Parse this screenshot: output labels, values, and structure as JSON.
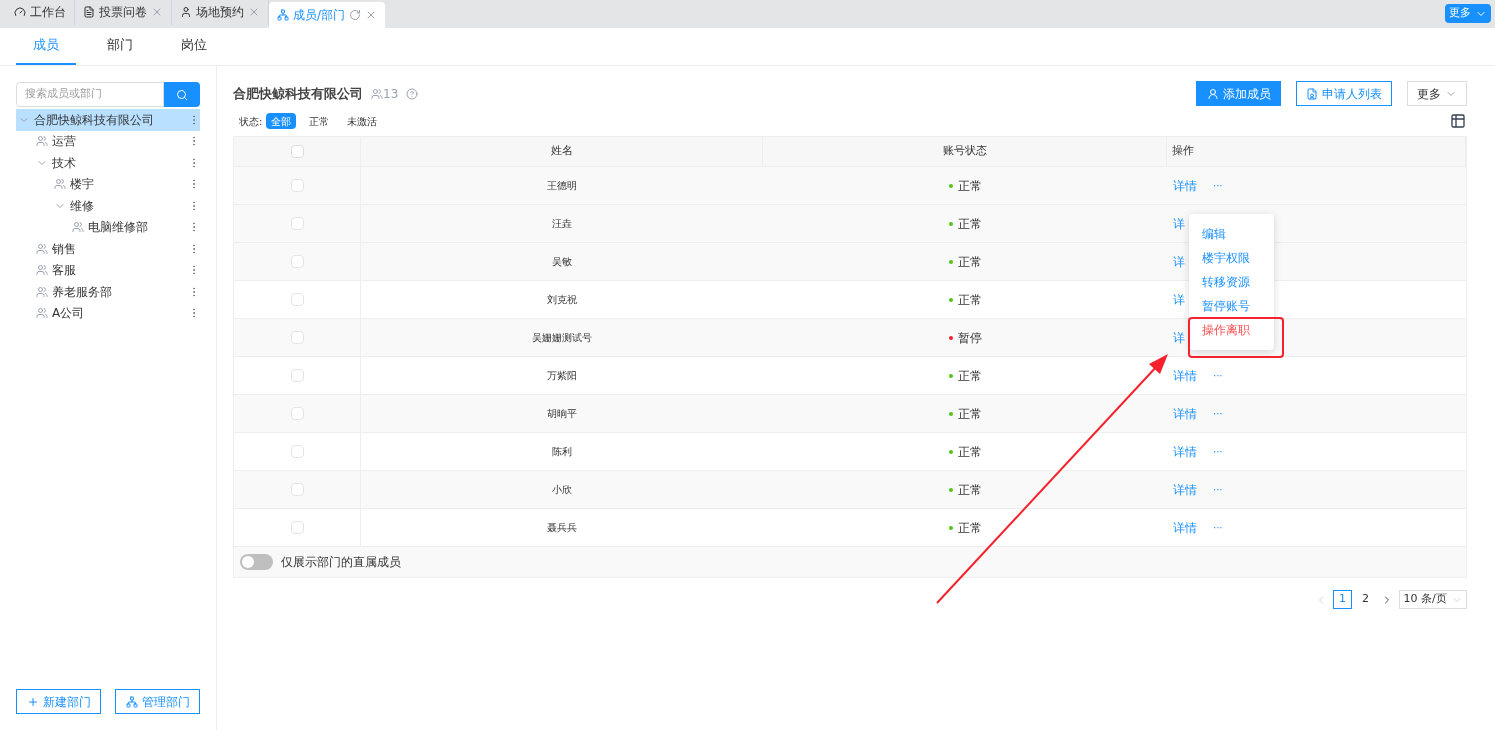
{
  "tabs": [
    {
      "label": "工作台",
      "selected": false,
      "closable": false
    },
    {
      "label": "投票问卷",
      "selected": false,
      "closable": true
    },
    {
      "label": "场地预约",
      "selected": false,
      "closable": true
    },
    {
      "label": "成员/部门",
      "selected": true,
      "closable": true
    }
  ],
  "more_button": "更多",
  "sub_tabs": [
    {
      "label": "成员",
      "selected": true
    },
    {
      "label": "部门",
      "selected": false
    },
    {
      "label": "岗位",
      "selected": false
    }
  ],
  "sidebar": {
    "search": {
      "placeholder": "搜索成员或部门"
    },
    "tree": [
      {
        "label": "合肥快鲸科技有限公司",
        "selected": true,
        "expanded": true,
        "children": [
          {
            "label": "运营",
            "selected": false
          },
          {
            "label": "技术",
            "selected": false,
            "expanded": true,
            "children": [
              {
                "label": "楼宇",
                "selected": false
              },
              {
                "label": "维修",
                "selected": false,
                "expanded": true,
                "children": [
                  {
                    "label": "电脑维修部",
                    "selected": false
                  }
                ]
              }
            ]
          },
          {
            "label": "销售",
            "selected": false
          },
          {
            "label": "客服",
            "selected": false
          },
          {
            "label": "养老服务部",
            "selected": false
          },
          {
            "label": "A公司",
            "selected": false
          }
        ]
      }
    ],
    "buttons": [
      "新建部门",
      "管理部门"
    ]
  },
  "header": {
    "company": "合肥快鲸科技有限公司",
    "member_count": "13",
    "buttons": [
      {
        "label": "添加成员",
        "kind": "primary"
      },
      {
        "label": "申请人列表",
        "kind": "outline"
      },
      {
        "label": "更多",
        "kind": "dropdown"
      }
    ]
  },
  "filter": {
    "label": "状态:",
    "options": [
      {
        "label": "全部",
        "selected": true
      },
      {
        "label": "正常",
        "selected": false
      },
      {
        "label": "未激活",
        "selected": false
      }
    ]
  },
  "table": {
    "select_all": {
      "checked": false
    },
    "columns": [
      "姓名",
      "账号状态",
      "操作"
    ],
    "rows": [
      {
        "checked": false,
        "name": "王德明",
        "status": "正常",
        "color": "#52c41a",
        "action": "详情",
        "more": "···"
      },
      {
        "checked": false,
        "name": "汪垚",
        "status": "正常",
        "color": "#52c41a",
        "action": "详",
        "more": ""
      },
      {
        "checked": false,
        "name": "吴敏",
        "status": "正常",
        "color": "#52c41a",
        "action": "详",
        "more": ""
      },
      {
        "checked": false,
        "name": "刘克祝",
        "status": "正常",
        "color": "#52c41a",
        "action": "详",
        "more": ""
      },
      {
        "checked": false,
        "name": "吴姗姗测试号",
        "status": "暂停",
        "color": "#f5222d",
        "action": "详",
        "more": ""
      },
      {
        "checked": false,
        "name": "万紫阳",
        "status": "正常",
        "color": "#52c41a",
        "action": "详情",
        "more": "···"
      },
      {
        "checked": false,
        "name": "胡晌平",
        "status": "正常",
        "color": "#52c41a",
        "action": "详情",
        "more": "···"
      },
      {
        "checked": false,
        "name": "陈利",
        "status": "正常",
        "color": "#52c41a",
        "action": "详情",
        "more": "···"
      },
      {
        "checked": false,
        "name": "小欣",
        "status": "正常",
        "color": "#52c41a",
        "action": "详情",
        "more": "···"
      },
      {
        "checked": false,
        "name": "聂兵兵",
        "status": "正常",
        "color": "#52c41a",
        "action": "详情",
        "more": "···"
      }
    ],
    "toggle": {
      "label": "仅展示部门的直属成员",
      "on": false
    }
  },
  "menu": [
    {
      "label": "编辑",
      "danger": false
    },
    {
      "label": "楼宇权限",
      "danger": false
    },
    {
      "label": "转移资源",
      "danger": false
    },
    {
      "label": "暂停账号",
      "danger": false
    },
    {
      "label": "操作离职",
      "danger": true
    }
  ],
  "pagination": {
    "pages": [
      {
        "label": "1",
        "selected": true
      },
      {
        "label": "2",
        "selected": false
      }
    ],
    "page_size": "10 条/页"
  }
}
